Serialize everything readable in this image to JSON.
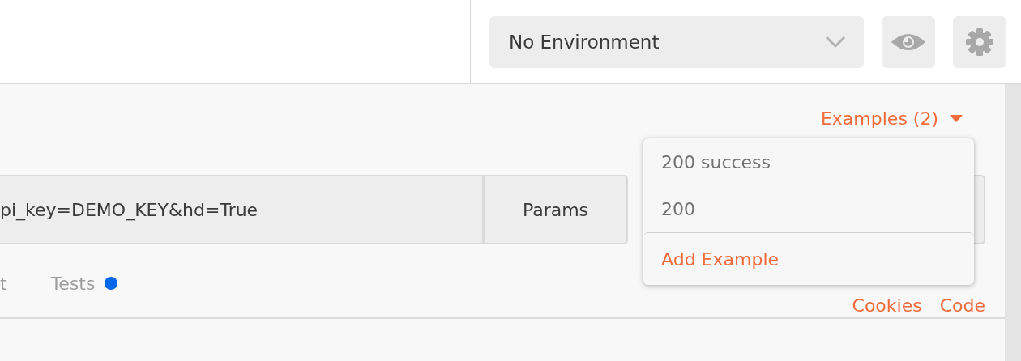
{
  "environment": {
    "value": "No Environment"
  },
  "examples_link": {
    "label": "Examples (2)"
  },
  "request": {
    "url": "pi_key=DEMO_KEY&hd=True",
    "params_button": "Params"
  },
  "tabs": [
    {
      "label": "t",
      "selected": false,
      "dot": false
    },
    {
      "label": "Tests",
      "selected": false,
      "dot": true
    }
  ],
  "links": [
    "Cookies",
    "Code"
  ],
  "examples_menu": [
    {
      "label": "200 success",
      "kind": "example"
    },
    {
      "label": "200",
      "kind": "example"
    },
    {
      "label": "Add Example",
      "kind": "action"
    }
  ]
}
